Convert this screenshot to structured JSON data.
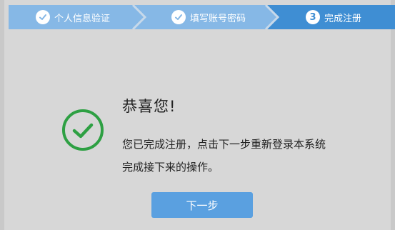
{
  "stepper": {
    "steps": [
      {
        "label": "个人信息验证",
        "status": "completed",
        "icon": "check-icon"
      },
      {
        "label": "填写账号密码",
        "status": "completed",
        "icon": "check-icon"
      },
      {
        "label": "完成注册",
        "status": "current",
        "number": "3"
      }
    ],
    "colors": {
      "completed": "#86b8e6",
      "current": "#3f8ed3",
      "arrow_edge": "#c7d9ea"
    }
  },
  "result": {
    "icon": "success-check-circle-icon",
    "icon_color": "#2ea043",
    "title": "恭喜您!",
    "message_line1": "您已完成注册，点击下一步重新登录本系统",
    "message_line2": "完成接下来的操作。"
  },
  "actions": {
    "next_label": "下一步",
    "next_color": "#5aa0e0"
  }
}
